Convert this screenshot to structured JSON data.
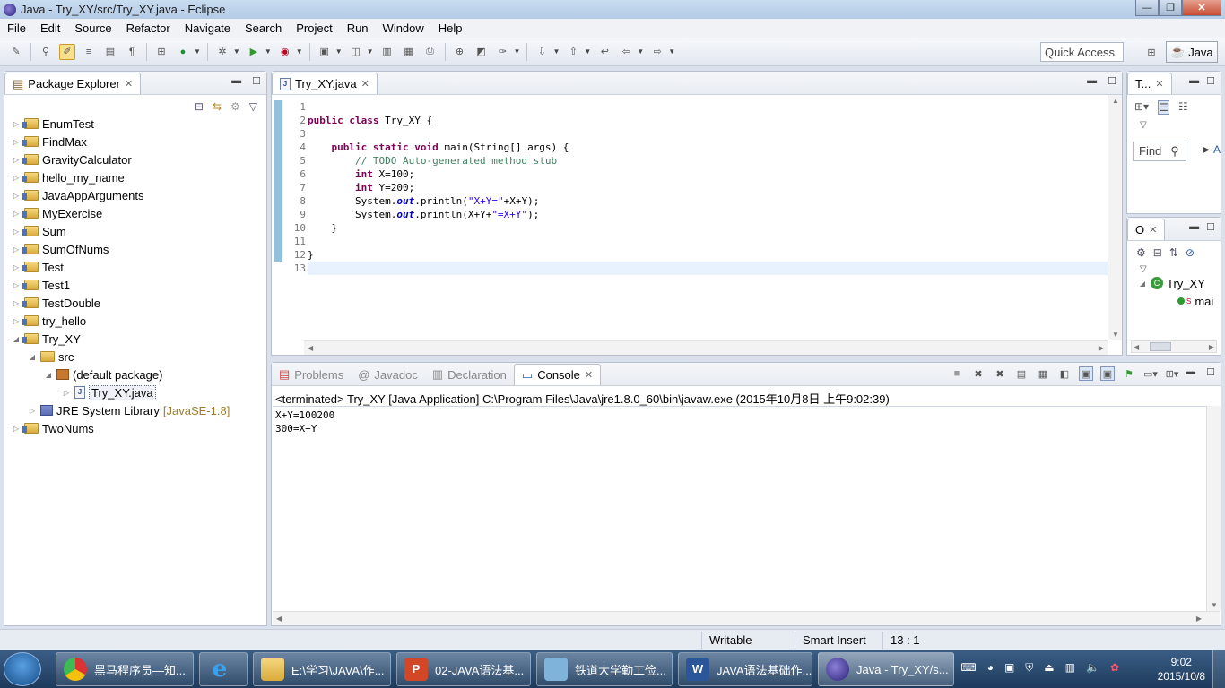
{
  "window": {
    "title": "Java - Try_XY/src/Try_XY.java - Eclipse"
  },
  "menu": [
    "File",
    "Edit",
    "Source",
    "Refactor",
    "Navigate",
    "Search",
    "Project",
    "Run",
    "Window",
    "Help"
  ],
  "toolbar": {
    "quick_access": "Quick Access",
    "perspective": "Java"
  },
  "package_explorer": {
    "title": "Package Explorer",
    "items": [
      {
        "label": "EnumTest"
      },
      {
        "label": "FindMax"
      },
      {
        "label": "GravityCalculator"
      },
      {
        "label": "hello_my_name"
      },
      {
        "label": "JavaAppArguments"
      },
      {
        "label": "MyExercise"
      },
      {
        "label": "Sum"
      },
      {
        "label": "SumOfNums"
      },
      {
        "label": "Test"
      },
      {
        "label": "Test1"
      },
      {
        "label": "TestDouble"
      },
      {
        "label": "try_hello"
      },
      {
        "label": "Try_XY"
      }
    ],
    "src": "src",
    "default_package": "(default package)",
    "file": "Try_XY.java",
    "jre": "JRE System Library",
    "jre_version": "[JavaSE-1.8]",
    "last_project": "TwoNums"
  },
  "editor": {
    "tab": "Try_XY.java",
    "line_numbers": [
      "1",
      "2",
      "3",
      "4",
      "5",
      "6",
      "7",
      "8",
      "9",
      "10",
      "11",
      "12",
      "13"
    ]
  },
  "outline_top": {
    "tab": "T...",
    "find_placeholder": "Find",
    "link": "A"
  },
  "outline": {
    "tab": "O",
    "class_name": "Try_XY",
    "method": "mai",
    "static_marker": "S"
  },
  "console": {
    "tabs": [
      "Problems",
      "Javadoc",
      "Declaration",
      "Console"
    ],
    "terminated": "<terminated> Try_XY [Java Application] C:\\Program Files\\Java\\jre1.8.0_60\\bin\\javaw.exe (2015年10月8日 上午9:02:39)",
    "output": [
      "X+Y=100200",
      "300=X+Y"
    ]
  },
  "status": {
    "writable": "Writable",
    "insert_mode": "Smart Insert",
    "position": "13 : 1"
  },
  "taskbar": {
    "items": [
      "黑马程序员—知...",
      "",
      "E:\\学习\\JAVA\\作...",
      "02-JAVA语法基...",
      "铁道大学勤工俭...",
      "JAVA语法基础作...",
      "Java - Try_XY/s..."
    ],
    "time": "9:02",
    "date": "2015/10/8"
  },
  "colors": {
    "keyword": "#7f0055",
    "comment": "#3f7f5f",
    "string": "#2a00ff",
    "field": "#0000c0"
  }
}
